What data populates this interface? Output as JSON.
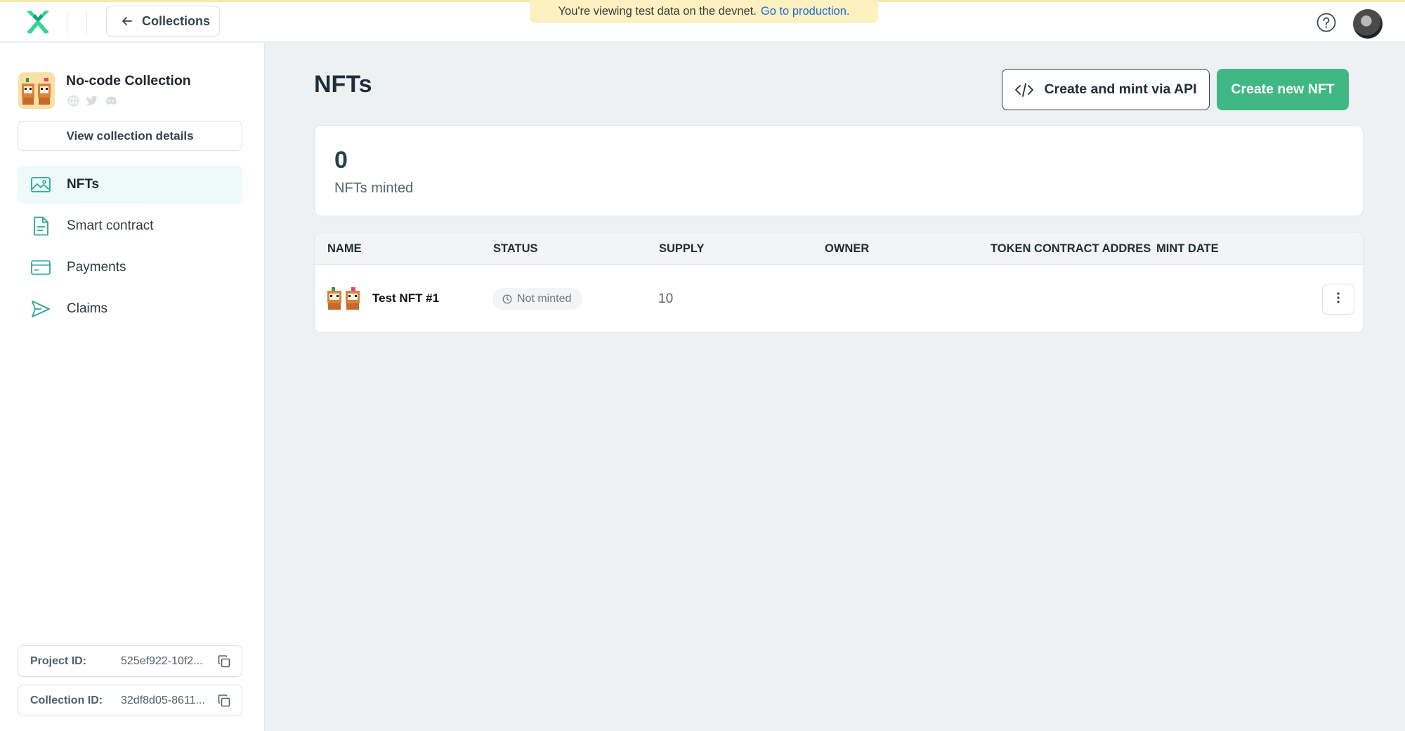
{
  "topbar": {
    "back_label": "Collections",
    "banner_text": "You're viewing test data on the devnet.",
    "banner_link": "Go to production."
  },
  "sidebar": {
    "collection_title": "No-code Collection",
    "view_details_label": "View collection details",
    "nav": [
      {
        "label": "NFTs",
        "icon": "image-icon",
        "active": true
      },
      {
        "label": "Smart contract",
        "icon": "document-icon",
        "active": false
      },
      {
        "label": "Payments",
        "icon": "credit-card-icon",
        "active": false
      },
      {
        "label": "Claims",
        "icon": "send-icon",
        "active": false
      }
    ],
    "project_id_label": "Project ID:",
    "project_id_value": "525ef922-10f2...",
    "collection_id_label": "Collection ID:",
    "collection_id_value": "32df8d05-8611..."
  },
  "main": {
    "title": "NFTs",
    "api_button": "Create and mint via API",
    "new_button": "Create new NFT",
    "stats": {
      "value": "0",
      "label": "NFTs minted"
    },
    "table": {
      "columns": [
        "NAME",
        "STATUS",
        "SUPPLY",
        "OWNER",
        "TOKEN CONTRACT ADDRESS",
        "MINT DATE"
      ],
      "rows": [
        {
          "name": "Test NFT #1",
          "status": "Not minted",
          "supply": "10",
          "owner": "",
          "token_contract_address": "",
          "mint_date": ""
        }
      ]
    }
  },
  "colors": {
    "accent": "#3fb883",
    "banner_bg": "#fdf1c2",
    "link": "#1d6bd6",
    "active_nav_bg": "#eefafa"
  }
}
